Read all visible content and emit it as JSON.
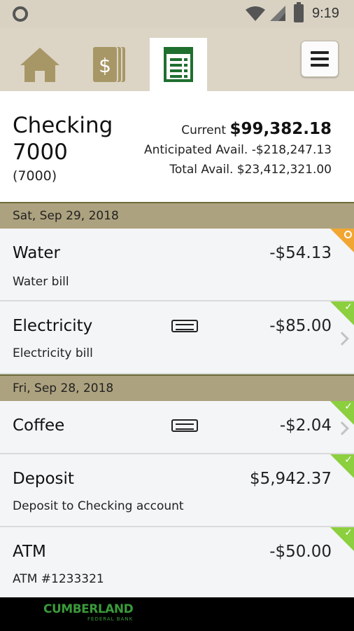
{
  "status_bar": {
    "time": "9:19"
  },
  "nav": {
    "tabs": [
      {
        "icon": "home-icon",
        "active": false
      },
      {
        "icon": "money-icon",
        "active": false
      },
      {
        "icon": "ledger-icon",
        "active": true
      }
    ],
    "menu_icon": "hamburger-menu-icon"
  },
  "account": {
    "name": "Checking 7000",
    "number": "(7000)",
    "current_label": "Current",
    "current_value": "$99,382.18",
    "anticipated_line": "Anticipated Avail. -$218,247.13",
    "total_line": "Total Avail. $23,412,321.00"
  },
  "groups": [
    {
      "date": "Sat, Sep 29, 2018",
      "transactions": [
        {
          "title": "Water",
          "desc": "Water bill",
          "amount": "-$54.13",
          "status": "pending"
        },
        {
          "title": "Electricity",
          "desc": "Electricity bill",
          "amount": "-$85.00",
          "status": "cleared",
          "card": true,
          "chevron": true
        }
      ]
    },
    {
      "date": "Fri, Sep 28, 2018",
      "transactions": [
        {
          "title": "Coffee",
          "desc": "",
          "amount": "-$2.04",
          "status": "cleared",
          "card": true,
          "chevron": true
        },
        {
          "title": "Deposit",
          "desc": "Deposit to Checking account",
          "amount": "$5,942.37",
          "status": "cleared"
        },
        {
          "title": "ATM",
          "desc": "ATM #1233321",
          "amount": "-$50.00",
          "status": "cleared"
        }
      ]
    }
  ],
  "footer": {
    "logo_line1": "CUMBERLAND",
    "logo_line2": "FEDERAL BANK"
  },
  "colors": {
    "accent": "#ada27f",
    "cleared": "#8ccf3f",
    "pending": "#f1a631",
    "logo": "#3a9a3a"
  }
}
